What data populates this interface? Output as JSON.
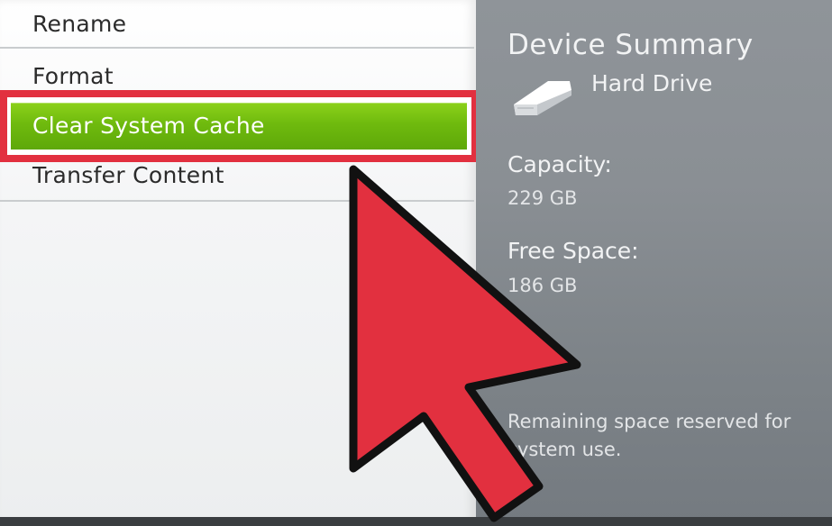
{
  "menu": {
    "items": [
      {
        "label": "Rename"
      },
      {
        "label": "Format"
      },
      {
        "label": "Clear System Cache"
      },
      {
        "label": "Transfer Content"
      }
    ]
  },
  "summary": {
    "title": "Device Summary",
    "device": "Hard Drive",
    "capacity_label": "Capacity:",
    "capacity_value": "229 GB",
    "free_label": "Free Space:",
    "free_value": "186 GB",
    "note": "Remaining space reserved for system use."
  },
  "icons": {
    "drive": "hard-drive-icon",
    "annotation": "pointer-arrow"
  },
  "colors": {
    "selected": "#6fba0e",
    "annotation": "#e2303f",
    "panel": "#8a8f94"
  }
}
